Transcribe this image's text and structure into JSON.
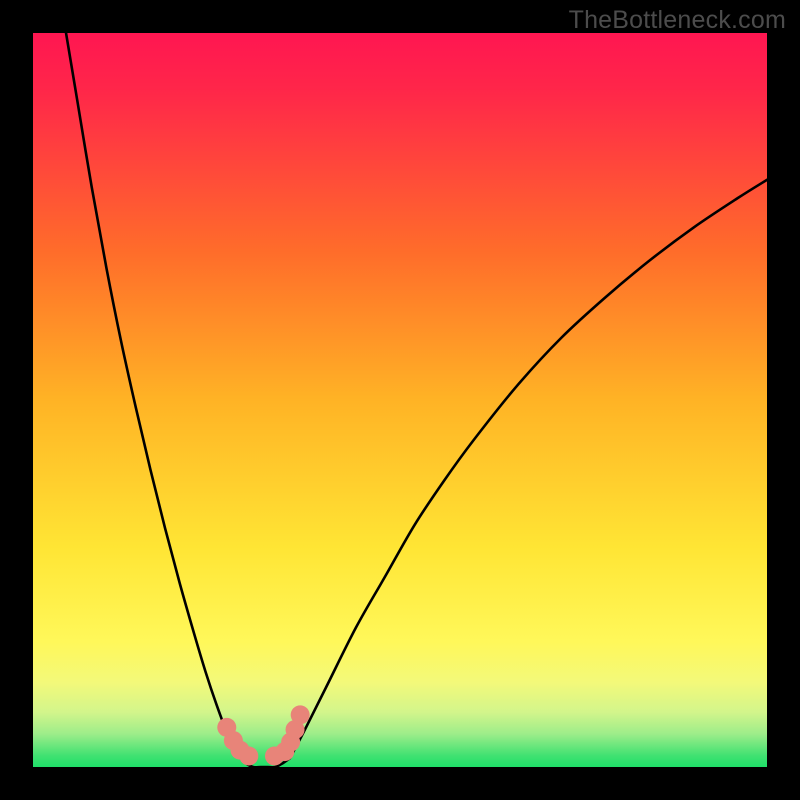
{
  "watermark": "TheBottleneck.com",
  "colors": {
    "frame": "#000000",
    "gradient_top": "#ff1651",
    "gradient_mid1": "#ff8a23",
    "gradient_mid2": "#fff547",
    "gradient_bottom": "#21e36a",
    "curve": "#000000",
    "marker": "#e88479"
  },
  "chart_data": {
    "type": "line",
    "title": "",
    "xlabel": "",
    "ylabel": "",
    "xlim": [
      0,
      100
    ],
    "ylim": [
      0,
      100
    ],
    "series": [
      {
        "name": "left-branch",
        "x": [
          4.5,
          6,
          8,
          10,
          12,
          14,
          16,
          18,
          20,
          22,
          23.5,
          25,
          26.5,
          28
        ],
        "values": [
          100,
          91,
          79,
          68,
          58,
          49,
          40.5,
          32.5,
          25,
          18,
          13,
          8.5,
          4.5,
          1.5
        ]
      },
      {
        "name": "flat-bottom",
        "x": [
          28,
          29,
          30,
          31,
          32,
          33,
          34,
          35
        ],
        "values": [
          1.5,
          0.5,
          0,
          0,
          0,
          0,
          0.5,
          1.2
        ]
      },
      {
        "name": "right-branch",
        "x": [
          35,
          37,
          40,
          44,
          48,
          52,
          56,
          60,
          66,
          72,
          78,
          84,
          90,
          96,
          100
        ],
        "values": [
          1.2,
          5,
          11,
          19,
          26,
          33,
          39,
          44.5,
          52,
          58.5,
          64,
          69,
          73.5,
          77.5,
          80
        ]
      }
    ],
    "markers": {
      "name": "highlight-points",
      "x": [
        26.4,
        27.3,
        28.2,
        29.4,
        32.9,
        34.3,
        35.1,
        35.7,
        36.4
      ],
      "values": [
        5.4,
        3.6,
        2.3,
        1.5,
        1.5,
        2.1,
        3.4,
        5.1,
        7.1
      ]
    },
    "background": "vertical-gradient red→orange→yellow→green"
  }
}
